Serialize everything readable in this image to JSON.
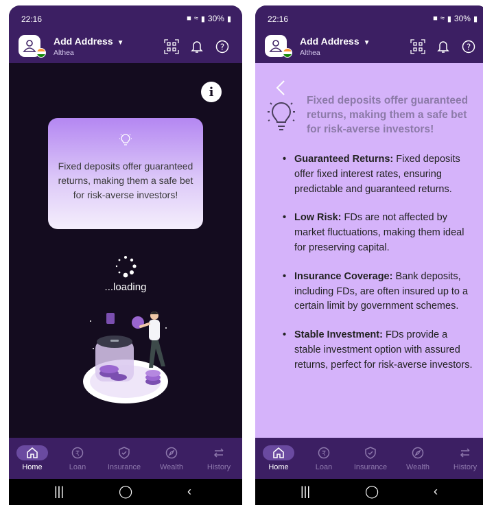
{
  "status_bar": {
    "time": "22:16",
    "battery": "30%"
  },
  "header": {
    "title": "Add Address",
    "subtitle": "Althea"
  },
  "loading_screen": {
    "tip": "Fixed deposits offer guaranteed returns, making them a safe bet for risk-averse investors!",
    "loading_text": "...loading"
  },
  "detail_screen": {
    "headline": "Fixed deposits offer guaranteed returns, making them a safe bet for risk-averse investors!",
    "points": [
      {
        "title": "Guaranteed Returns:",
        "text": " Fixed deposits offer fixed interest rates, ensuring predictable and guaranteed returns."
      },
      {
        "title": "Low Risk:",
        "text": " FDs are not affected by market fluctuations, making them ideal for preserving capital."
      },
      {
        "title": "Insurance Coverage:",
        "text": " Bank deposits, including FDs, are often insured up to a certain limit by government schemes."
      },
      {
        "title": "Stable Investment:",
        "text": " FDs provide a stable investment option with assured returns, perfect for risk-averse investors."
      }
    ]
  },
  "nav": [
    {
      "label": "Home",
      "icon": "home-icon",
      "active": true
    },
    {
      "label": "Loan",
      "icon": "rupee-icon"
    },
    {
      "label": "Insurance",
      "icon": "shield-check-icon"
    },
    {
      "label": "Wealth",
      "icon": "compass-icon"
    },
    {
      "label": "History",
      "icon": "swap-arrows-icon"
    }
  ],
  "colors": {
    "header_bg": "#3c1f63",
    "dark_bg": "#140c1f",
    "light_bg": "#d5b3fa",
    "nav_active": "#6a4aa0"
  }
}
